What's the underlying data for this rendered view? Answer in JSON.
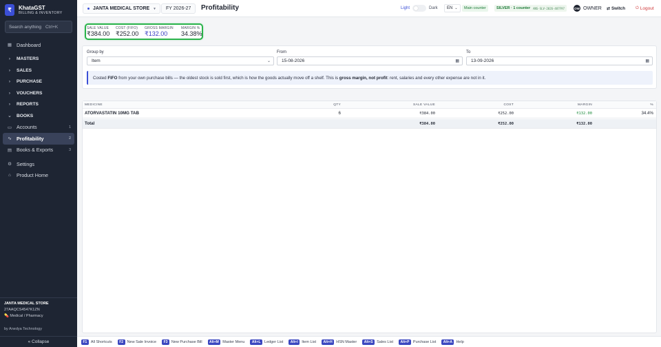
{
  "brand": {
    "logo": "₹",
    "name": "KhataGST",
    "sub": "BILLING & INVENTORY"
  },
  "search": {
    "placeholder": "Search anything",
    "shortcut": "Ctrl+K"
  },
  "nav": [
    {
      "label": "Dashboard",
      "icon": "grid-icon"
    },
    {
      "label": "MASTERS",
      "icon": "chevron-right-icon"
    },
    {
      "label": "SALES",
      "icon": "chevron-right-icon"
    },
    {
      "label": "PURCHASE",
      "icon": "chevron-right-icon"
    },
    {
      "label": "VOUCHERS",
      "icon": "chevron-right-icon"
    },
    {
      "label": "REPORTS",
      "icon": "chevron-right-icon"
    },
    {
      "label": "BOOKS",
      "icon": "chevron-down-icon"
    },
    {
      "label": "Accounts",
      "badge": "1"
    },
    {
      "label": "Profitability",
      "badge": "2"
    },
    {
      "label": "Books & Exports",
      "badge": "3"
    },
    {
      "label": "Settings"
    },
    {
      "label": "Product Home"
    }
  ],
  "store": {
    "name": "JANTA MEDICAL STORE",
    "gstin": "27AAQCS4547K1ZN",
    "category": "Medical / Pharmacy"
  },
  "byline": "by Anedya Technology",
  "collapse_label": "« Collapse",
  "topbar": {
    "store_name": "JANTA MEDICAL STORE",
    "fy": "FY 2026-27",
    "title": "Profitability",
    "theme_light": "Light",
    "theme_dark": "Dark",
    "lang": "EN",
    "counter": "Main counter",
    "license": "SILVER · 1 counter",
    "license_key": "ANS-SLV-2026-487F97",
    "owner_initials": "OW",
    "owner": "OWNER",
    "switch_label": "Switch",
    "logout_label": "Logout"
  },
  "stats": [
    {
      "label": "SALE VALUE",
      "value": "₹384.00"
    },
    {
      "label": "COST (FIFO)",
      "value": "₹252.00"
    },
    {
      "label": "GROSS MARGIN",
      "value": "₹132.00"
    },
    {
      "label": "MARGIN %",
      "value": "34.38%"
    }
  ],
  "filters": {
    "group_by_label": "Group by",
    "group_by_value": "Item",
    "from_label": "From",
    "from_value": "15-08-2026",
    "to_label": "To",
    "to_value": "13-09-2026"
  },
  "note": {
    "p1": "Costed ",
    "b1": "FIFO",
    "p2": " from your own purchase bills — the oldest stock is sold first, which is how the goods actually move off a shelf. This is ",
    "b2": "gross margin, not profit",
    "p3": ": rent, salaries and every other expense are not in it."
  },
  "table": {
    "headers": [
      "MEDICINE",
      "QTY",
      "SALE VALUE",
      "COST",
      "MARGIN",
      "%"
    ],
    "rows": [
      {
        "medicine": "ATORVASTATIN 10MG TAB",
        "qty": "6",
        "sale": "₹384.00",
        "cost": "₹252.00",
        "margin": "₹132.00",
        "pct": "34.4%"
      }
    ],
    "total": {
      "label": "Total",
      "sale": "₹384.00",
      "cost": "₹252.00",
      "margin": "₹132.00"
    }
  },
  "shortcuts": [
    {
      "key": "F1",
      "label": "All Shortcuts"
    },
    {
      "key": "F2",
      "label": "New Sale Invoice"
    },
    {
      "key": "F3",
      "label": "New Purchase Bill"
    },
    {
      "key": "Alt+M",
      "label": "Master Menu"
    },
    {
      "key": "Alt+L",
      "label": "Ledger List"
    },
    {
      "key": "Alt+I",
      "label": "Item List"
    },
    {
      "key": "Alt+H",
      "label": "HSN Master"
    },
    {
      "key": "Alt+S",
      "label": "Sales List"
    },
    {
      "key": "Alt+P",
      "label": "Purchase List"
    },
    {
      "key": "Alt+A",
      "label": "Help"
    }
  ],
  "colors": {
    "accent": "#3b4fd6",
    "sidebar": "#1e2533",
    "positive": "#1a8a3a",
    "highlight_border": "#29b34a"
  }
}
